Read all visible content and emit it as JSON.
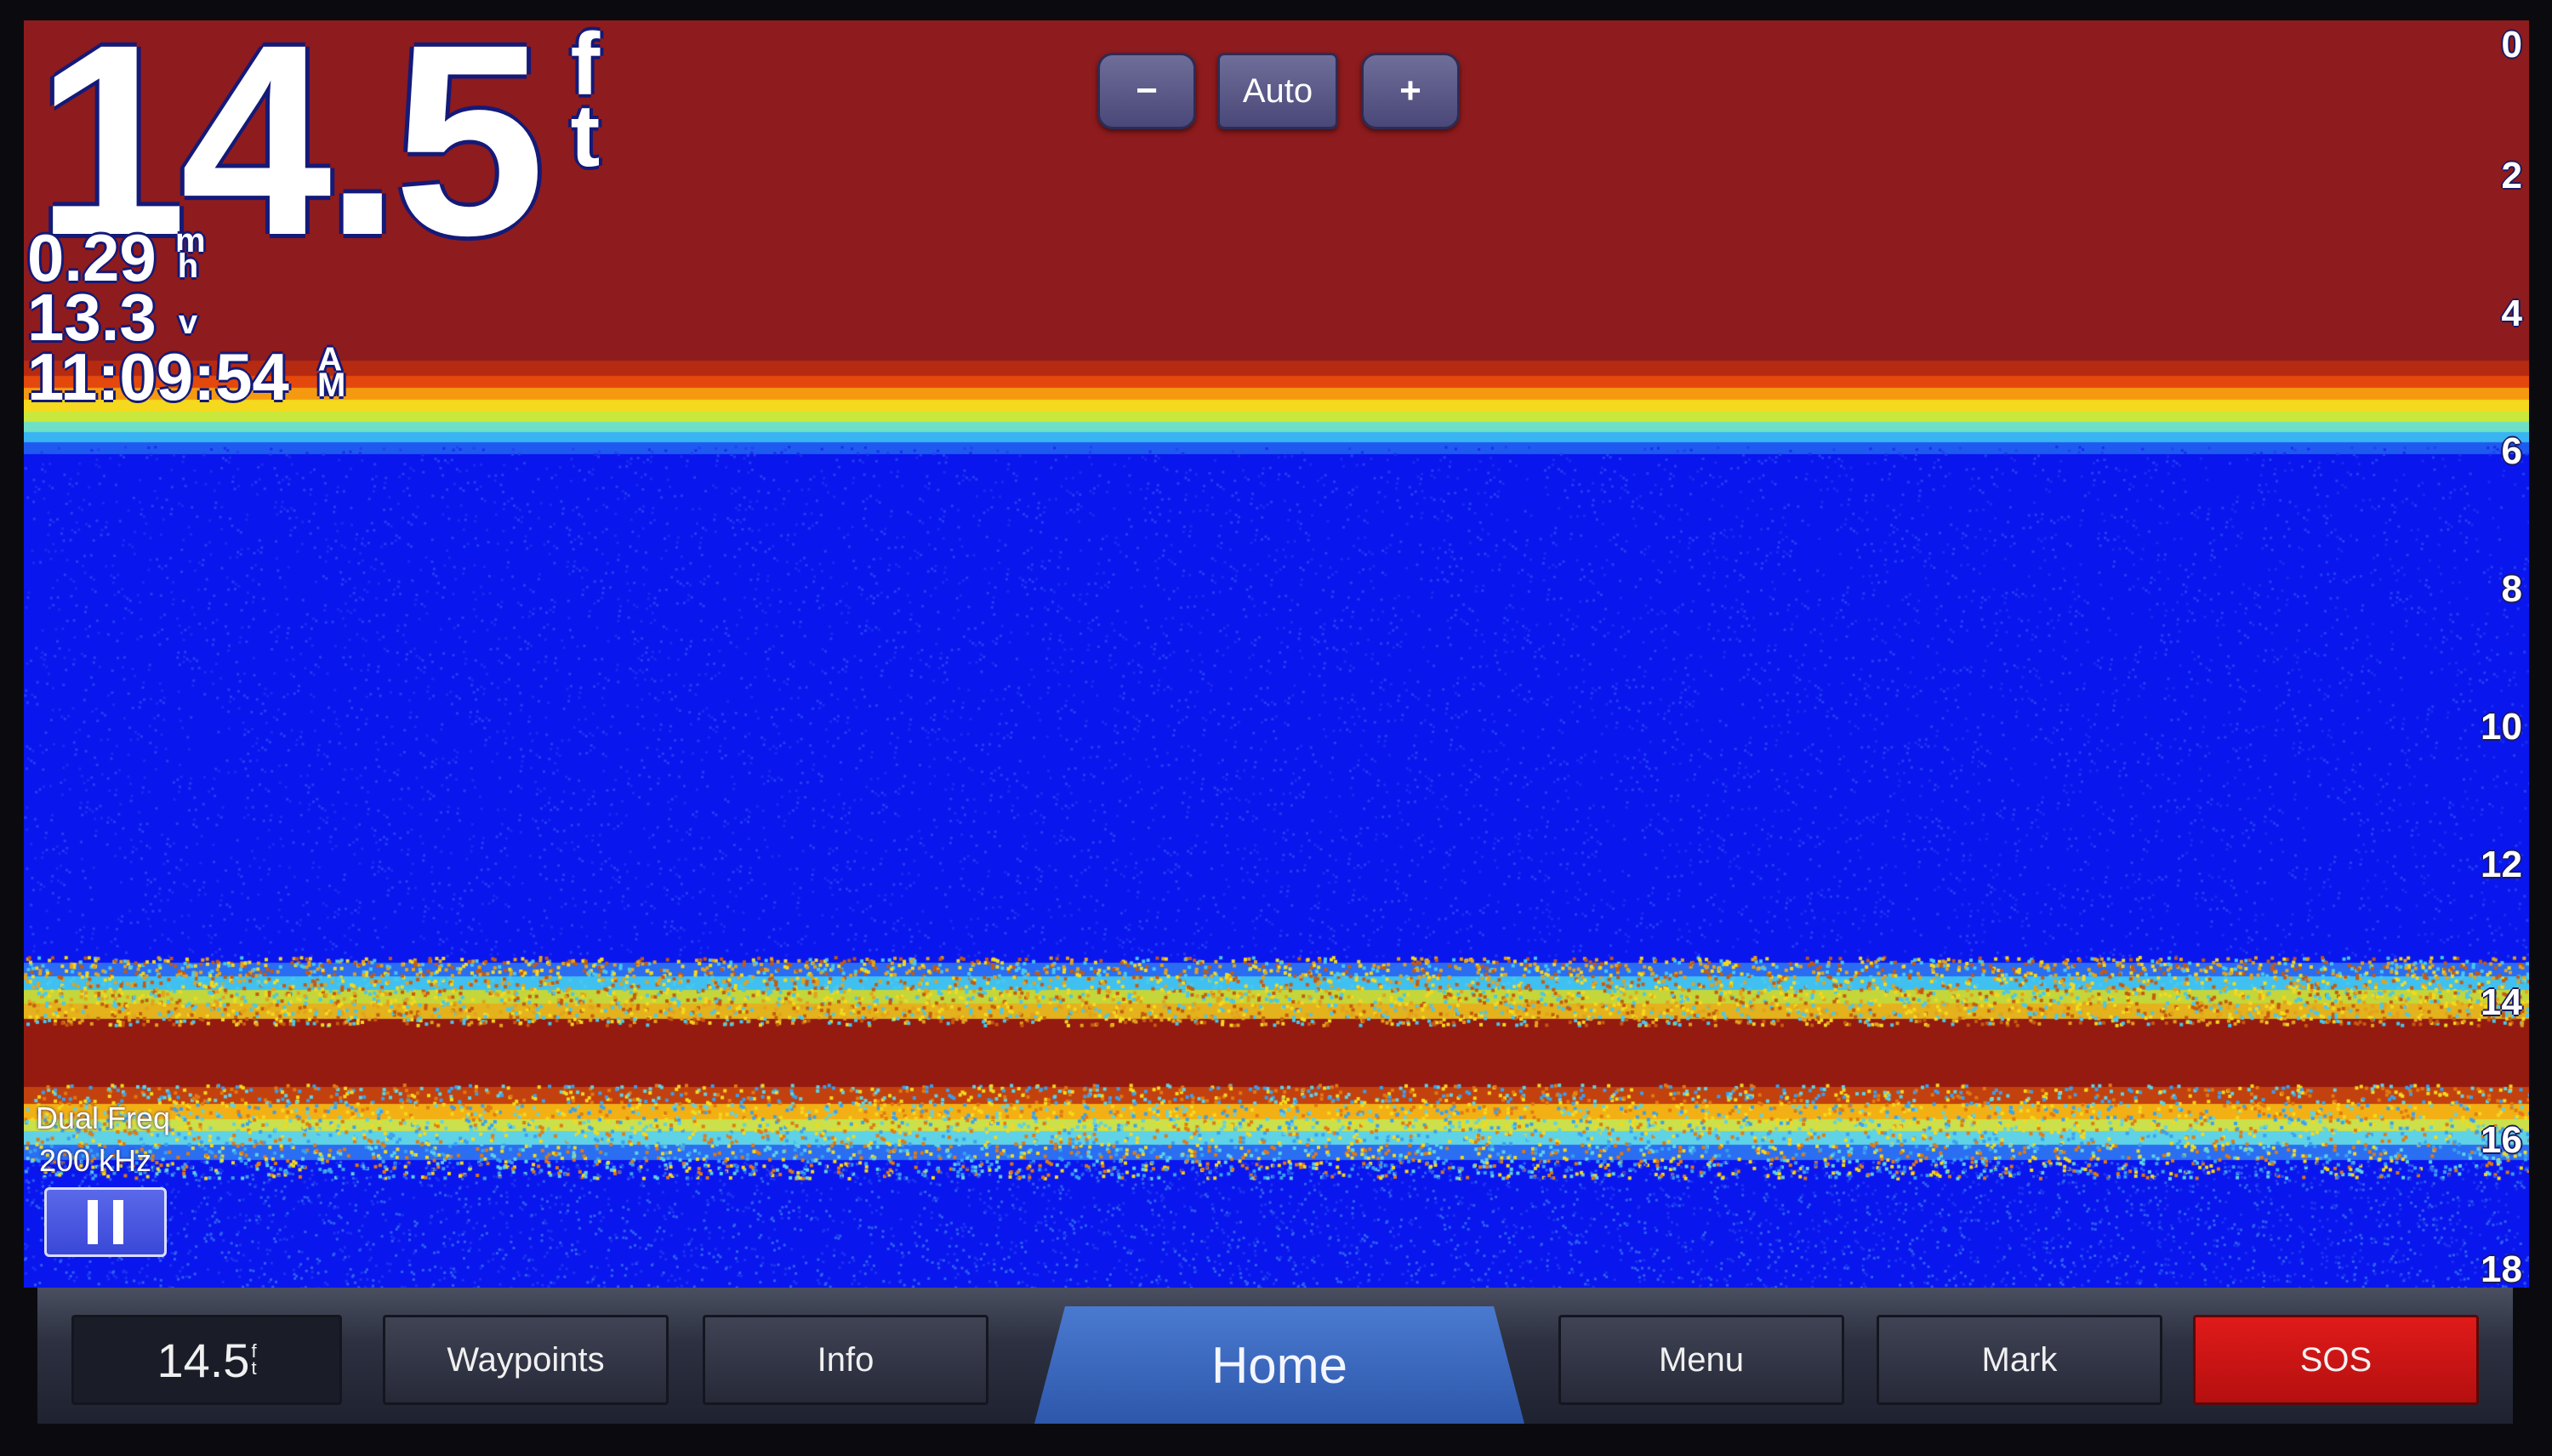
{
  "depth": {
    "value": "14.5",
    "unit_top": "f",
    "unit_bottom": "t"
  },
  "speed": {
    "value": "0.29",
    "unit_top": "m",
    "unit_bottom": "h"
  },
  "voltage": {
    "value": "13.3",
    "unit": "v"
  },
  "clock": {
    "value": "11:09:54",
    "unit_top": "A",
    "unit_bottom": "M"
  },
  "zoom": {
    "minus_label": "−",
    "auto_label": "Auto",
    "plus_label": "+"
  },
  "depth_scale": [
    "0",
    "2",
    "4",
    "6",
    "8",
    "10",
    "12",
    "14",
    "16",
    "18"
  ],
  "frequency": {
    "mode": "Dual Freq",
    "value": "200 kHz"
  },
  "bottom_bar": {
    "depth_readout": "14.5",
    "depth_readout_unit_top": "f",
    "depth_readout_unit_bottom": "t",
    "waypoints_label": "Waypoints",
    "info_label": "Info",
    "home_label": "Home",
    "menu_label": "Menu",
    "mark_label": "Mark",
    "sos_label": "SOS"
  },
  "colors": {
    "surface_clutter": "#8e1b1d",
    "water": "#0a16ee",
    "bottom_return": "#951a0f",
    "sos": "#d91616",
    "home": "#3a68c0"
  }
}
